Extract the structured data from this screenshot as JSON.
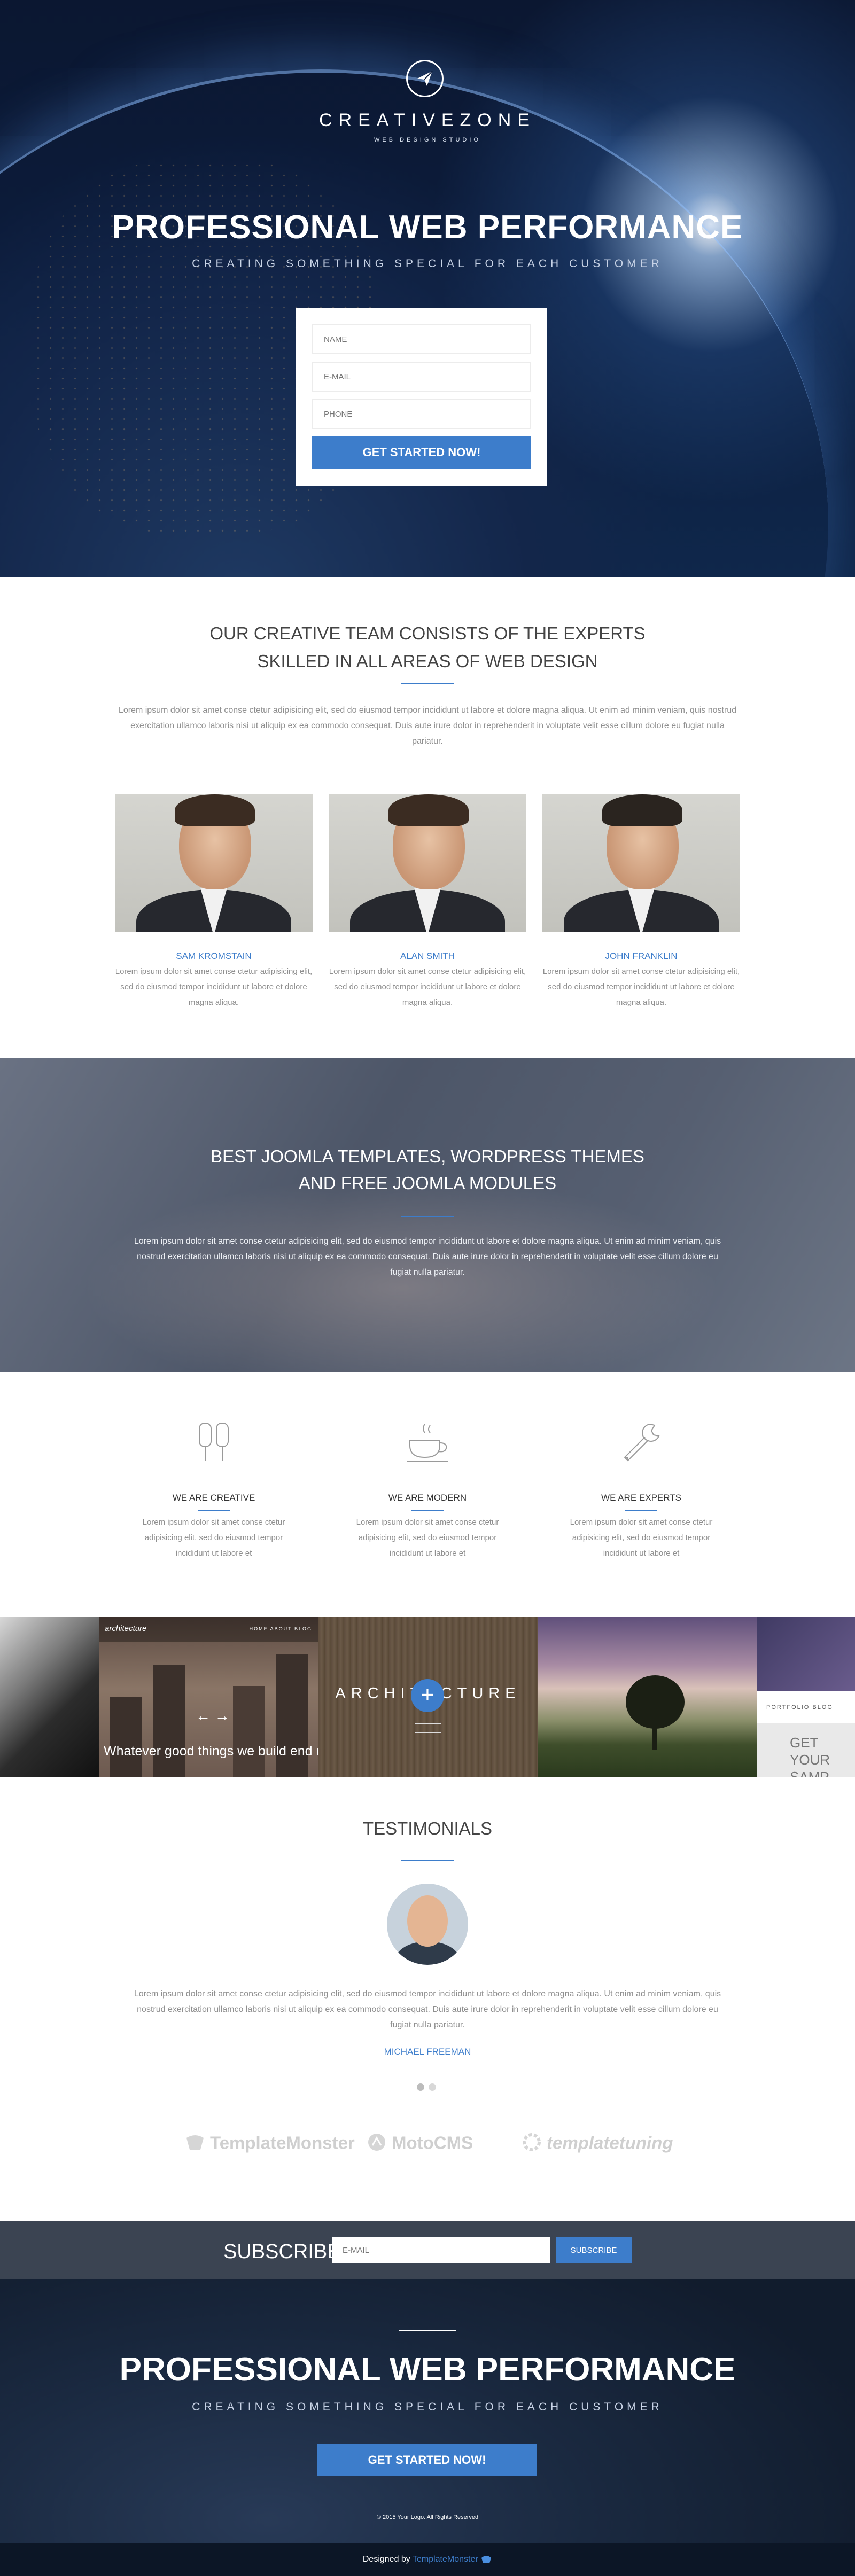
{
  "hero": {
    "brand": "CREATIVEZONE",
    "brand_sub": "WEB DESIGN STUDIO",
    "title": "PROFESSIONAL WEB PERFORMANCE",
    "tagline": "CREATING SOMETHING SPECIAL FOR EACH CUSTOMER",
    "form": {
      "name_placeholder": "NAME",
      "email_placeholder": "E-MAIL",
      "phone_placeholder": "PHONE",
      "submit_label": "GET STARTED NOW!"
    }
  },
  "team": {
    "heading_line1": "OUR CREATIVE TEAM CONSISTS OF THE EXPERTS",
    "heading_line2": "SKILLED IN ALL AREAS OF WEB DESIGN",
    "intro": "Lorem ipsum dolor sit amet conse ctetur adipisicing elit, sed do eiusmod tempor incididunt ut labore et dolore magna aliqua. Ut enim ad minim veniam, quis nostrud exercitation ullamco laboris nisi ut aliquip ex ea commodo consequat. Duis aute irure dolor in reprehenderit in voluptate velit esse cillum dolore eu fugiat nulla pariatur.",
    "members": [
      {
        "name": "SAM KROMSTAIN",
        "desc": "Lorem ipsum dolor sit amet conse ctetur adipisicing elit, sed do eiusmod tempor incididunt ut labore et dolore magna aliqua."
      },
      {
        "name": "ALAN SMITH",
        "desc": "Lorem ipsum dolor sit amet conse ctetur adipisicing elit, sed do eiusmod tempor incididunt ut labore et dolore magna aliqua."
      },
      {
        "name": "JOHN FRANKLIN",
        "desc": "Lorem ipsum dolor sit amet conse ctetur adipisicing elit, sed do eiusmod tempor incididunt ut labore et dolore magna aliqua."
      }
    ]
  },
  "promo": {
    "heading_line1": "BEST JOOMLA TEMPLATES, WORDPRESS THEMES",
    "heading_line2": "AND FREE JOOMLA MODULES",
    "text": "Lorem ipsum dolor sit amet conse ctetur adipisicing elit, sed do eiusmod tempor incididunt ut labore et dolore magna aliqua. Ut enim ad minim veniam, quis nostrud exercitation ullamco laboris nisi ut aliquip ex ea commodo consequat. Duis aute irure dolor in reprehenderit in voluptate velit esse cillum dolore eu fugiat nulla pariatur."
  },
  "features": [
    {
      "icon": "popsicle-icon",
      "title": "WE ARE CREATIVE",
      "desc": "Lorem ipsum dolor sit amet conse ctetur adipisicing elit, sed do eiusmod tempor incididunt ut labore et"
    },
    {
      "icon": "coffee-cup-icon",
      "title": "WE ARE MODERN",
      "desc": "Lorem ipsum dolor sit amet conse ctetur adipisicing elit, sed do eiusmod tempor incididunt ut labore et"
    },
    {
      "icon": "wrench-icon",
      "title": "WE ARE EXPERTS",
      "desc": "Lorem ipsum dolor sit amet conse ctetur adipisicing elit, sed do eiusmod tempor incididunt ut labore et"
    }
  ],
  "gallery": {
    "arch_brand": "architecture",
    "arch_nav": "HOME   ABOUT   BLOG",
    "arch_slogan": "Whatever good things we build end u",
    "arch_title": "ARCHITECTURE",
    "plus_symbol": "+",
    "portfolio_nav": "PORTFOLIO   BLOG",
    "portfolio_text": "GET YOUR SAMP"
  },
  "testimonials": {
    "heading": "TESTIMONIALS",
    "quote": "Lorem ipsum dolor sit amet conse ctetur adipisicing elit, sed do eiusmod tempor incididunt ut labore et dolore magna aliqua. Ut enim ad minim veniam, quis nostrud exercitation ullamco laboris nisi ut aliquip ex ea commodo consequat. Duis aute irure dolor in reprehenderit in voluptate velit esse cillum dolore eu fugiat nulla pariatur.",
    "author": "MICHAEL FREEMAN",
    "partners": [
      "TemplateMonster",
      "MotoCMS",
      "templatetuning"
    ]
  },
  "subscribe": {
    "label": "SUBSCRIBE",
    "email_placeholder": "E-MAIL",
    "button_label": "SUBSCRIBE"
  },
  "footer": {
    "title": "PROFESSIONAL WEB PERFORMANCE",
    "tagline": "CREATING SOMETHING SPECIAL FOR EACH CUSTOMER",
    "cta_label": "GET STARTED NOW!",
    "copyright": "© 2015 Your Logo. All Rights Reserved",
    "credit_prefix": "Designed by ",
    "credit_brand": "TemplateMonster"
  },
  "colors": {
    "accent": "#3d7dcb",
    "dark_band": "#3b4452"
  }
}
